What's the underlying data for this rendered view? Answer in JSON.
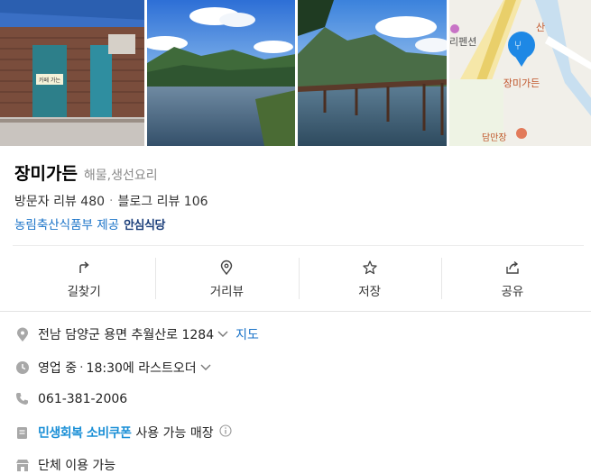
{
  "photos": [
    {
      "name": "photo-storefront"
    },
    {
      "name": "photo-river-1"
    },
    {
      "name": "photo-bridge"
    },
    {
      "name": "photo-map"
    }
  ],
  "map": {
    "pin_label": "장미가든",
    "nearby_label": "담만장",
    "top_label": "산",
    "side_label": "리펜션",
    "pin_color": "#1e88e5"
  },
  "store": {
    "sign_text": "카페 가는"
  },
  "place": {
    "name": "장미가든",
    "category": "해물,생선요리",
    "visitor_reviews": "방문자 리뷰 480",
    "blog_reviews": "블로그 리뷰 106",
    "cert_text": "농림축산식품부 제공",
    "cert_badge": "안심식당"
  },
  "actions": [
    {
      "label": "길찾기",
      "icon": "directions-icon"
    },
    {
      "label": "거리뷰",
      "icon": "street-view-icon"
    },
    {
      "label": "저장",
      "icon": "star-icon"
    },
    {
      "label": "공유",
      "icon": "share-icon"
    }
  ],
  "info": {
    "address": "전남 담양군 용면 추월산로 1284",
    "map_link": "지도",
    "status": "영업 중",
    "hours_detail": "18:30에 라스트오더",
    "phone": "061-381-2006",
    "coupon_name": "민생회복 소비쿠폰",
    "coupon_text": "사용 가능 매장",
    "group": "단체 이용 가능"
  },
  "colors": {
    "link": "#1a73c8",
    "badge": "#1b3e7a",
    "coupon": "#1a8fd6"
  }
}
